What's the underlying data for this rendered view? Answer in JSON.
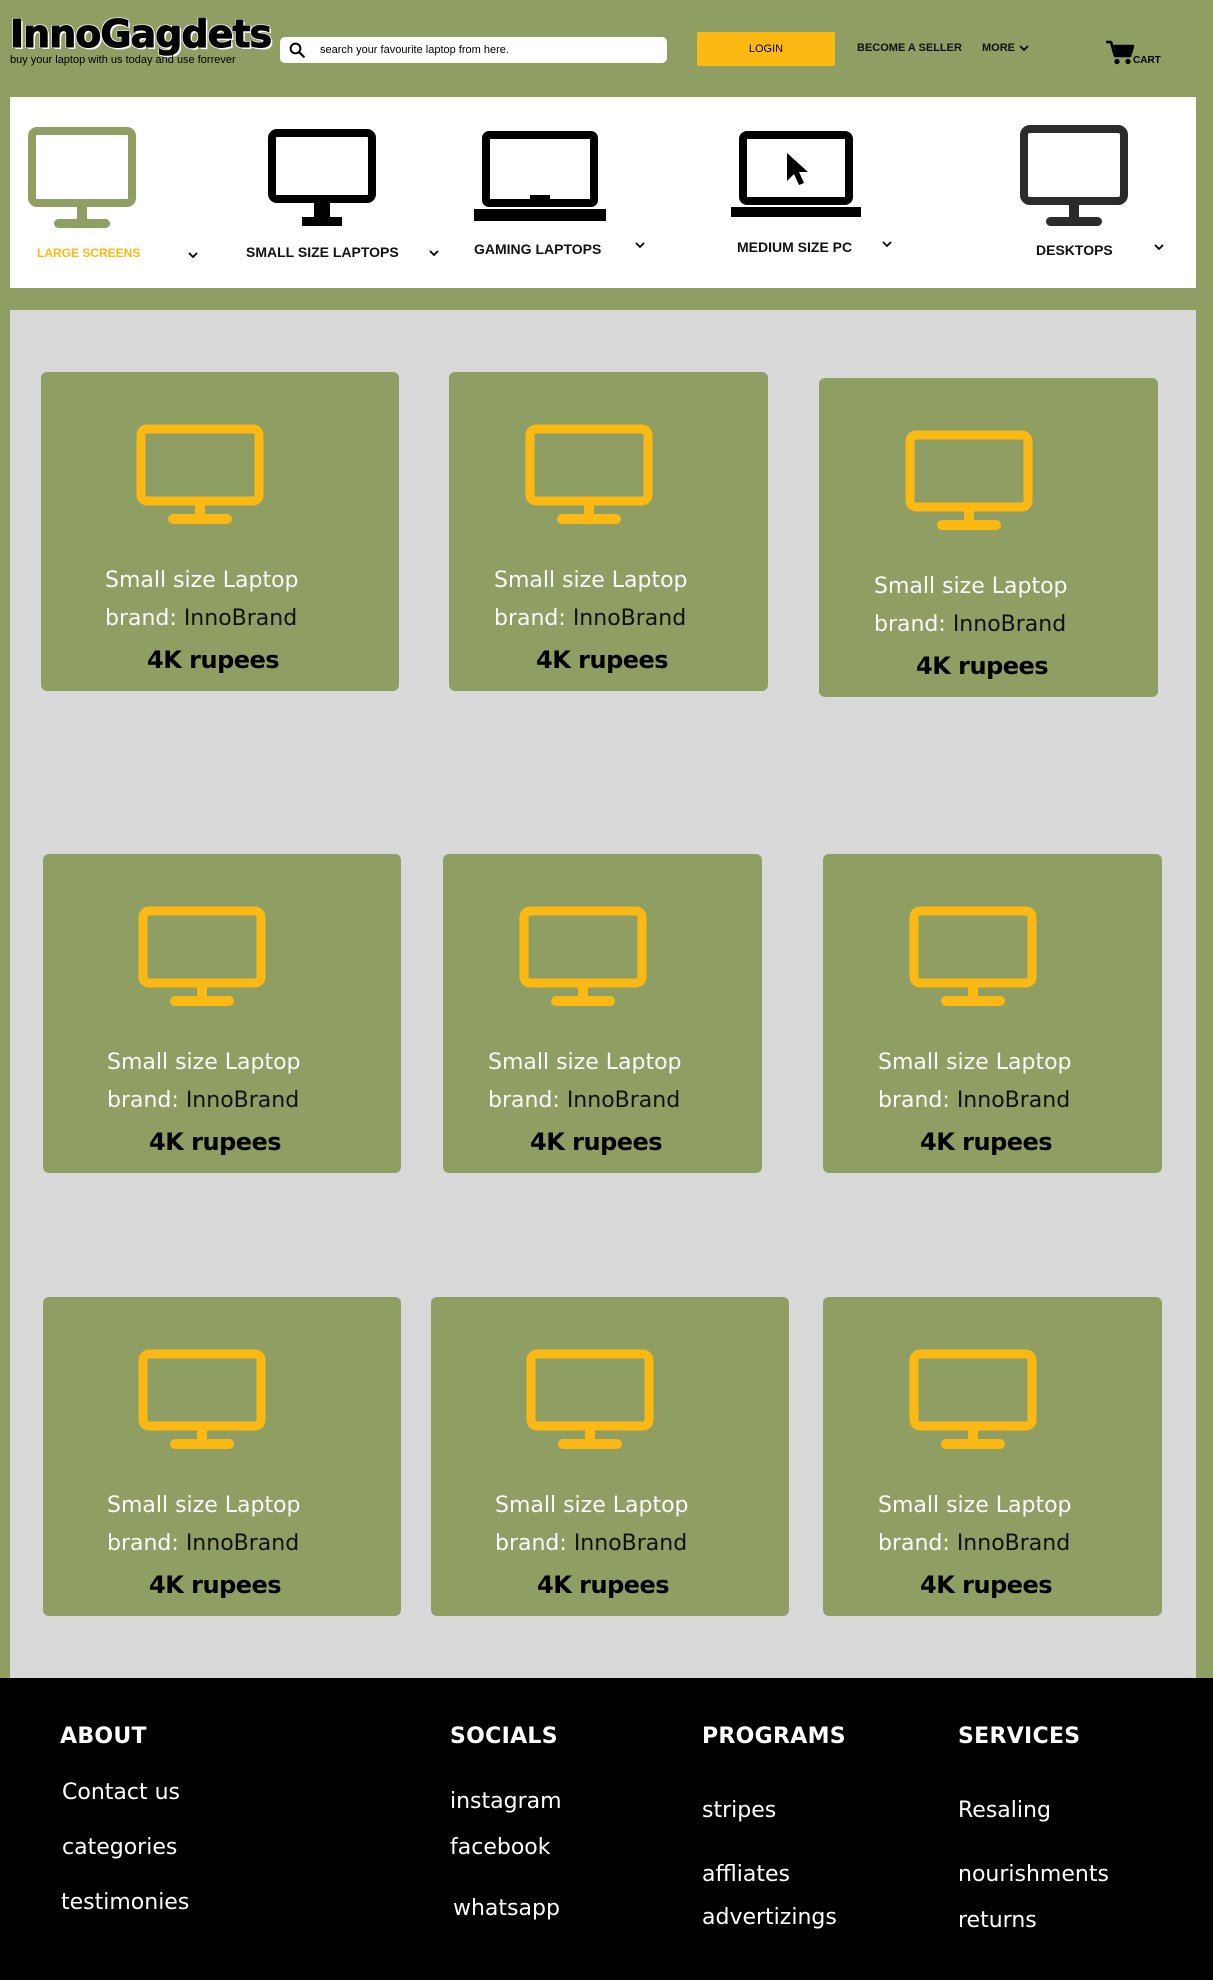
{
  "header": {
    "logo_title": "InnoGagdets",
    "logo_tagline": "buy your laptop with us  today and use forrever",
    "search_placeholder": "search your favourite laptop from here.",
    "login_label": "LOGIN",
    "become_seller_label": "BECOME A SELLER",
    "more_label": "MORE",
    "cart_label": "CART"
  },
  "categories": [
    {
      "label": "LARGE SCREENS",
      "icon": "monitor-icon",
      "active": true
    },
    {
      "label": "SMALL SIZE LAPTOPS",
      "icon": "monitor-icon"
    },
    {
      "label": "GAMING LAPTOPS",
      "icon": "laptop-icon"
    },
    {
      "label": "MEDIUM  SIZE  PC",
      "icon": "laptop-cursor-icon"
    },
    {
      "label": "DESKTOPS",
      "icon": "monitor-icon"
    }
  ],
  "products": [
    {
      "name": "Small size Laptop",
      "brand_prefix": "brand:",
      "brand": "InnoBrand",
      "price": "4K rupees"
    },
    {
      "name": "Small size Laptop",
      "brand_prefix": "brand:",
      "brand": "InnoBrand",
      "price": "4K rupees"
    },
    {
      "name": "Small size Laptop",
      "brand_prefix": "brand:",
      "brand": "InnoBrand",
      "price": "4K rupees"
    },
    {
      "name": "Small size Laptop",
      "brand_prefix": "brand:",
      "brand": "InnoBrand",
      "price": "4K rupees"
    },
    {
      "name": "Small size Laptop",
      "brand_prefix": "brand:",
      "brand": "InnoBrand",
      "price": "4K rupees"
    },
    {
      "name": "Small size Laptop",
      "brand_prefix": "brand:",
      "brand": "InnoBrand",
      "price": "4K rupees"
    },
    {
      "name": "Small size Laptop",
      "brand_prefix": "brand:",
      "brand": "InnoBrand",
      "price": "4K rupees"
    },
    {
      "name": "Small size Laptop",
      "brand_prefix": "brand:",
      "brand": "InnoBrand",
      "price": "4K rupees"
    },
    {
      "name": "Small size Laptop",
      "brand_prefix": "brand:",
      "brand": "InnoBrand",
      "price": "4K rupees"
    }
  ],
  "footer": {
    "about": {
      "heading": "ABOUT",
      "links": [
        "Contact us",
        "categories",
        "testimonies"
      ]
    },
    "socials": {
      "heading": "SOCIALS",
      "links": [
        "instagram",
        "facebook",
        "whatsapp"
      ]
    },
    "programs": {
      "heading": "PROGRAMS",
      "links": [
        "stripes",
        "affliates",
        "advertizings"
      ]
    },
    "services": {
      "heading": "SERVICES",
      "links": [
        "Resaling",
        "nourishments",
        "returns"
      ]
    }
  },
  "colors": {
    "page_bg": "#8f9e62",
    "accent_yellow": "#fdb913",
    "products_bg": "#d9d9d9",
    "footer_bg": "#000000"
  }
}
